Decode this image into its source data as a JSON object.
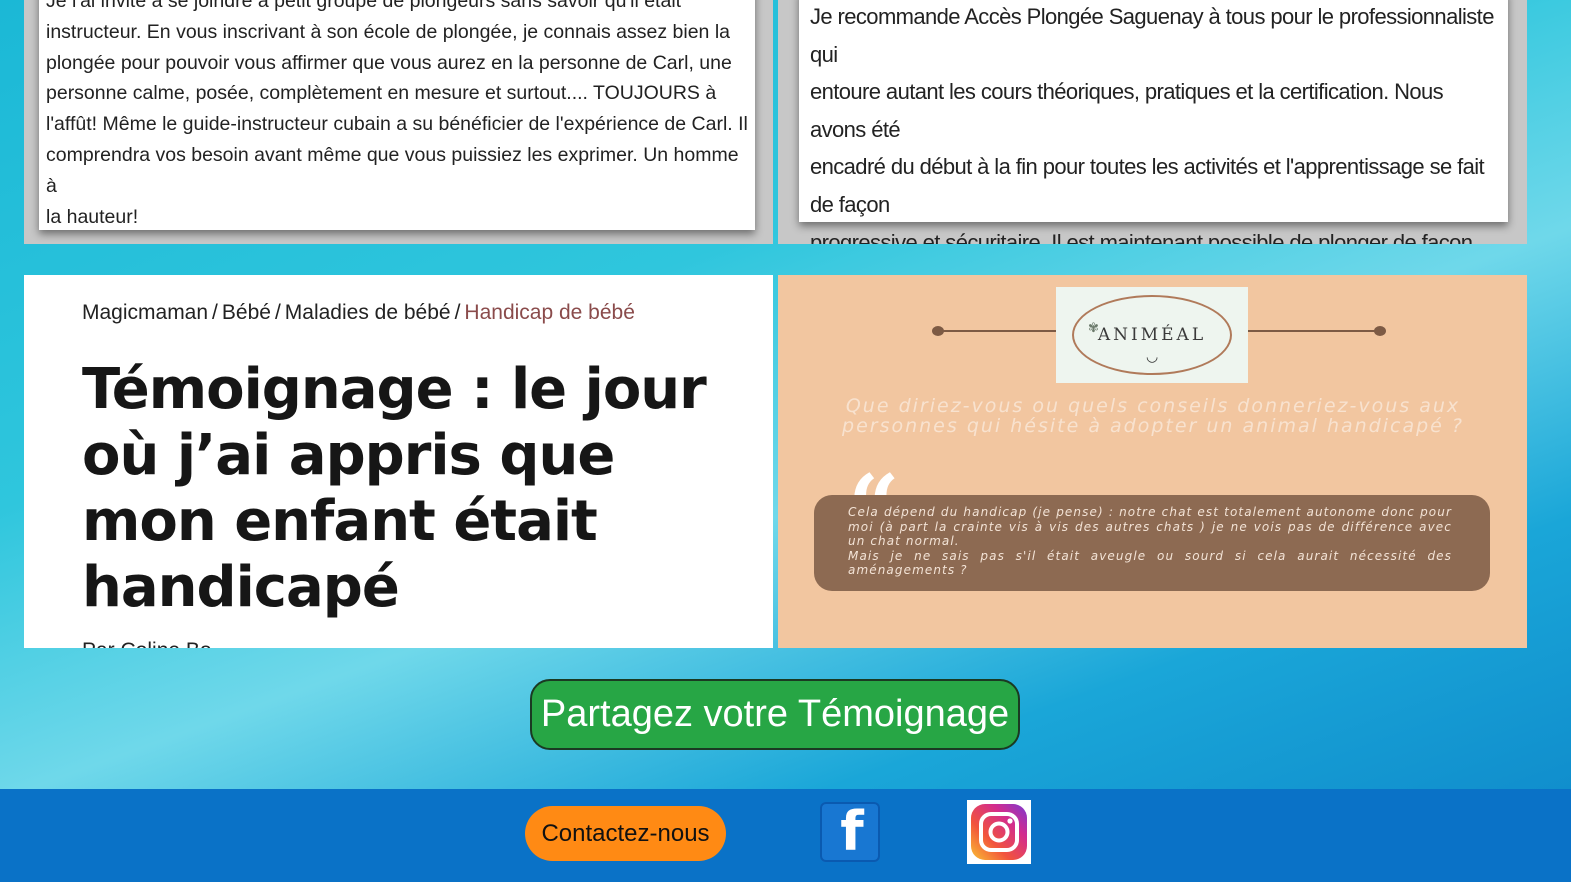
{
  "reviews": {
    "left_text": "Je l'ai invité à se joindre à petit groupe de plongeurs sans savoir qu'il était\ninstructeur. En vous inscrivant à son école de plongée, je connais assez bien la\nplongée pour pouvoir vous affirmer que vous aurez en la personne de Carl, une\npersonne calme, posée, complètement en mesure et surtout.... TOUJOURS à\nl'affût! Même le guide-instructeur cubain a su bénéficier de l'expérience de Carl. Il\ncomprendra vos besoin avant même que vous puissiez les exprimer. Un homme à\nla hauteur!",
    "right_text": "Je recommande Accès Plongée Saguenay à tous pour le professionnaliste qui\nentoure autant les cours théoriques, pratiques et la certification. Nous avons été\nencadré du début à la fin pour toutes les activités et l'apprentissage se fait de façon\nprogressive et sécuritaire. Il est maintenant possible de plonger de façon autonome\net de participer à des plongées encadrées dans le fjord et autres endroits à\ndécouvrir au Québec ou ailleurs."
  },
  "article": {
    "breadcrumb": [
      "Magicmaman",
      "Bébé",
      "Maladies de bébé",
      "Handicap de bébé"
    ],
    "separator": "/",
    "title": "Témoignage : le jour où j’ai appris que mon enfant était handicapé",
    "byline": "Par Coline Bo..."
  },
  "animeal": {
    "logo_text": "ANIMÉAL",
    "question": "Que diriez-vous ou quels conseils donneriez-vous aux personnes qui hésite à adopter un animal handicapé ?",
    "quote_mark": "“",
    "answer": "Cela dépend du handicap (je pense) : notre chat est totalement autonome donc pour moi (à part la crainte vis à vis des autres chats ) je ne vois pas de différence avec un chat normal.\nMais je ne sais pas s'il était aveugle ou sourd si cela aurait nécessité des aménagements ?"
  },
  "share_button": "Partagez votre Témoignage",
  "footer": {
    "contact_button": "Contactez-nous",
    "facebook_icon": "facebook-icon",
    "instagram_icon": "instagram-icon",
    "facebook_letter": "f"
  },
  "colors": {
    "share_green": "#27a645",
    "contact_orange": "#ff8a14",
    "footer_blue": "#0a72c7",
    "animeal_peach": "#f2c6a0",
    "answer_brown": "#8d6a52"
  }
}
